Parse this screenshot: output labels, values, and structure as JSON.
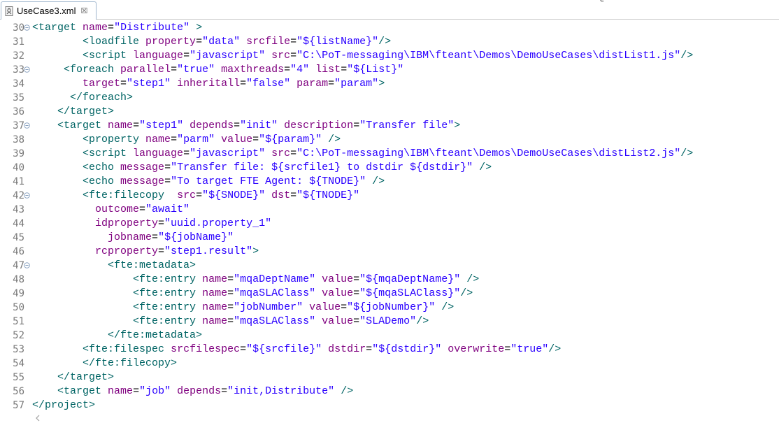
{
  "tab": {
    "title": "UseCase3.xml",
    "close_glyph": "☒",
    "icon": "xml-file-icon"
  },
  "colors": {
    "tag": "#006464",
    "attribute": "#7f007f",
    "value": "#2a00ff",
    "line_number": "#787878",
    "fold_marker": "#8aa2c0"
  },
  "lines": [
    {
      "num": "30",
      "fold": true,
      "tokens": [
        [
          "tag",
          "<target"
        ],
        [
          "plain",
          " "
        ],
        [
          "attr",
          "name"
        ],
        [
          "plain",
          "="
        ],
        [
          "val",
          "\"Distribute\""
        ],
        [
          "plain",
          " "
        ],
        [
          "tag",
          ">"
        ]
      ]
    },
    {
      "num": "31",
      "fold": false,
      "tokens": [
        [
          "plain",
          "        "
        ],
        [
          "tag",
          "<loadfile"
        ],
        [
          "plain",
          " "
        ],
        [
          "attr",
          "property"
        ],
        [
          "plain",
          "="
        ],
        [
          "val",
          "\"data\""
        ],
        [
          "plain",
          " "
        ],
        [
          "attr",
          "srcfile"
        ],
        [
          "plain",
          "="
        ],
        [
          "val",
          "\"${listName}\""
        ],
        [
          "tag",
          "/>"
        ]
      ]
    },
    {
      "num": "32",
      "fold": false,
      "tokens": [
        [
          "plain",
          "        "
        ],
        [
          "tag",
          "<script"
        ],
        [
          "plain",
          " "
        ],
        [
          "attr",
          "language"
        ],
        [
          "plain",
          "="
        ],
        [
          "val",
          "\"javascript\""
        ],
        [
          "plain",
          " "
        ],
        [
          "attr",
          "src"
        ],
        [
          "plain",
          "="
        ],
        [
          "val",
          "\"C:\\PoT-messaging\\IBM\\fteant\\Demos\\DemoUseCases\\distList1.js\""
        ],
        [
          "tag",
          "/>"
        ]
      ]
    },
    {
      "num": "33",
      "fold": true,
      "tokens": [
        [
          "plain",
          "     "
        ],
        [
          "tag",
          "<foreach"
        ],
        [
          "plain",
          " "
        ],
        [
          "attr",
          "parallel"
        ],
        [
          "plain",
          "="
        ],
        [
          "val",
          "\"true\""
        ],
        [
          "plain",
          " "
        ],
        [
          "attr",
          "maxthreads"
        ],
        [
          "plain",
          "="
        ],
        [
          "val",
          "\"4\""
        ],
        [
          "plain",
          " "
        ],
        [
          "attr",
          "list"
        ],
        [
          "plain",
          "="
        ],
        [
          "val",
          "\"${List}\""
        ]
      ]
    },
    {
      "num": "34",
      "fold": false,
      "tokens": [
        [
          "plain",
          "        "
        ],
        [
          "attr",
          "target"
        ],
        [
          "plain",
          "="
        ],
        [
          "val",
          "\"step1\""
        ],
        [
          "plain",
          " "
        ],
        [
          "attr",
          "inheritall"
        ],
        [
          "plain",
          "="
        ],
        [
          "val",
          "\"false\""
        ],
        [
          "plain",
          " "
        ],
        [
          "attr",
          "param"
        ],
        [
          "plain",
          "="
        ],
        [
          "val",
          "\"param\""
        ],
        [
          "tag",
          ">"
        ]
      ]
    },
    {
      "num": "35",
      "fold": false,
      "tokens": [
        [
          "plain",
          "      "
        ],
        [
          "tag",
          "</foreach>"
        ]
      ]
    },
    {
      "num": "36",
      "fold": false,
      "tokens": [
        [
          "plain",
          "    "
        ],
        [
          "tag",
          "</target>"
        ]
      ]
    },
    {
      "num": "37",
      "fold": true,
      "tokens": [
        [
          "plain",
          "    "
        ],
        [
          "tag",
          "<target"
        ],
        [
          "plain",
          " "
        ],
        [
          "attr",
          "name"
        ],
        [
          "plain",
          "="
        ],
        [
          "val",
          "\"step1\""
        ],
        [
          "plain",
          " "
        ],
        [
          "attr",
          "depends"
        ],
        [
          "plain",
          "="
        ],
        [
          "val",
          "\"init\""
        ],
        [
          "plain",
          " "
        ],
        [
          "attr",
          "description"
        ],
        [
          "plain",
          "="
        ],
        [
          "val",
          "\"Transfer file\""
        ],
        [
          "tag",
          ">"
        ]
      ]
    },
    {
      "num": "38",
      "fold": false,
      "tokens": [
        [
          "plain",
          "        "
        ],
        [
          "tag",
          "<property"
        ],
        [
          "plain",
          " "
        ],
        [
          "attr",
          "name"
        ],
        [
          "plain",
          "="
        ],
        [
          "val",
          "\"parm\""
        ],
        [
          "plain",
          " "
        ],
        [
          "attr",
          "value"
        ],
        [
          "plain",
          "="
        ],
        [
          "val",
          "\"${param}\""
        ],
        [
          "plain",
          " "
        ],
        [
          "tag",
          "/>"
        ]
      ]
    },
    {
      "num": "39",
      "fold": false,
      "tokens": [
        [
          "plain",
          "        "
        ],
        [
          "tag",
          "<script"
        ],
        [
          "plain",
          " "
        ],
        [
          "attr",
          "language"
        ],
        [
          "plain",
          "="
        ],
        [
          "val",
          "\"javascript\""
        ],
        [
          "plain",
          " "
        ],
        [
          "attr",
          "src"
        ],
        [
          "plain",
          "="
        ],
        [
          "val",
          "\"C:\\PoT-messaging\\IBM\\fteant\\Demos\\DemoUseCases\\distList2.js\""
        ],
        [
          "tag",
          "/>"
        ]
      ]
    },
    {
      "num": "40",
      "fold": false,
      "tokens": [
        [
          "plain",
          "        "
        ],
        [
          "tag",
          "<echo"
        ],
        [
          "plain",
          " "
        ],
        [
          "attr",
          "message"
        ],
        [
          "plain",
          "="
        ],
        [
          "val",
          "\"Transfer file: ${srcfile1} to dstdir ${dstdir}\""
        ],
        [
          "plain",
          " "
        ],
        [
          "tag",
          "/>"
        ]
      ]
    },
    {
      "num": "41",
      "fold": false,
      "tokens": [
        [
          "plain",
          "        "
        ],
        [
          "tag",
          "<echo"
        ],
        [
          "plain",
          " "
        ],
        [
          "attr",
          "message"
        ],
        [
          "plain",
          "="
        ],
        [
          "val",
          "\"To target FTE Agent: ${TNODE}\""
        ],
        [
          "plain",
          " "
        ],
        [
          "tag",
          "/>"
        ]
      ]
    },
    {
      "num": "42",
      "fold": true,
      "tokens": [
        [
          "plain",
          "        "
        ],
        [
          "tag",
          "<fte:filecopy"
        ],
        [
          "plain",
          "  "
        ],
        [
          "attr",
          "src"
        ],
        [
          "plain",
          "="
        ],
        [
          "val",
          "\"${SNODE}\""
        ],
        [
          "plain",
          " "
        ],
        [
          "attr",
          "dst"
        ],
        [
          "plain",
          "="
        ],
        [
          "val",
          "\"${TNODE}\""
        ]
      ]
    },
    {
      "num": "43",
      "fold": false,
      "tokens": [
        [
          "plain",
          "          "
        ],
        [
          "attr",
          "outcome"
        ],
        [
          "plain",
          "="
        ],
        [
          "val",
          "\"await\""
        ]
      ]
    },
    {
      "num": "44",
      "fold": false,
      "tokens": [
        [
          "plain",
          "          "
        ],
        [
          "attr",
          "idproperty"
        ],
        [
          "plain",
          "="
        ],
        [
          "val",
          "\"uuid.property_1\""
        ]
      ]
    },
    {
      "num": "45",
      "fold": false,
      "tokens": [
        [
          "plain",
          "            "
        ],
        [
          "attr",
          "jobname"
        ],
        [
          "plain",
          "="
        ],
        [
          "val",
          "\"${jobName}\""
        ]
      ]
    },
    {
      "num": "46",
      "fold": false,
      "tokens": [
        [
          "plain",
          "          "
        ],
        [
          "attr",
          "rcproperty"
        ],
        [
          "plain",
          "="
        ],
        [
          "val",
          "\"step1.result\""
        ],
        [
          "tag",
          ">"
        ]
      ]
    },
    {
      "num": "47",
      "fold": true,
      "tokens": [
        [
          "plain",
          "            "
        ],
        [
          "tag",
          "<fte:metadata>"
        ]
      ]
    },
    {
      "num": "48",
      "fold": false,
      "tokens": [
        [
          "plain",
          "                "
        ],
        [
          "tag",
          "<fte:entry"
        ],
        [
          "plain",
          " "
        ],
        [
          "attr",
          "name"
        ],
        [
          "plain",
          "="
        ],
        [
          "val",
          "\"mqaDeptName\""
        ],
        [
          "plain",
          " "
        ],
        [
          "attr",
          "value"
        ],
        [
          "plain",
          "="
        ],
        [
          "val",
          "\"${mqaDeptName}\""
        ],
        [
          "plain",
          " "
        ],
        [
          "tag",
          "/>"
        ]
      ]
    },
    {
      "num": "49",
      "fold": false,
      "tokens": [
        [
          "plain",
          "                "
        ],
        [
          "tag",
          "<fte:entry"
        ],
        [
          "plain",
          " "
        ],
        [
          "attr",
          "name"
        ],
        [
          "plain",
          "="
        ],
        [
          "val",
          "\"mqaSLAClass\""
        ],
        [
          "plain",
          " "
        ],
        [
          "attr",
          "value"
        ],
        [
          "plain",
          "="
        ],
        [
          "val",
          "\"${mqaSLAClass}\""
        ],
        [
          "tag",
          "/>"
        ]
      ]
    },
    {
      "num": "50",
      "fold": false,
      "tokens": [
        [
          "plain",
          "                "
        ],
        [
          "tag",
          "<fte:entry"
        ],
        [
          "plain",
          " "
        ],
        [
          "attr",
          "name"
        ],
        [
          "plain",
          "="
        ],
        [
          "val",
          "\"jobNumber\""
        ],
        [
          "plain",
          " "
        ],
        [
          "attr",
          "value"
        ],
        [
          "plain",
          "="
        ],
        [
          "val",
          "\"${jobNumber}\""
        ],
        [
          "plain",
          " "
        ],
        [
          "tag",
          "/>"
        ]
      ]
    },
    {
      "num": "51",
      "fold": false,
      "tokens": [
        [
          "plain",
          "                "
        ],
        [
          "tag",
          "<fte:entry"
        ],
        [
          "plain",
          " "
        ],
        [
          "attr",
          "name"
        ],
        [
          "plain",
          "="
        ],
        [
          "val",
          "\"mqaSLAClass\""
        ],
        [
          "plain",
          " "
        ],
        [
          "attr",
          "value"
        ],
        [
          "plain",
          "="
        ],
        [
          "val",
          "\"SLADemo\""
        ],
        [
          "tag",
          "/>"
        ]
      ]
    },
    {
      "num": "52",
      "fold": false,
      "tokens": [
        [
          "plain",
          "            "
        ],
        [
          "tag",
          "</fte:metadata>"
        ]
      ]
    },
    {
      "num": "53",
      "fold": false,
      "tokens": [
        [
          "plain",
          "        "
        ],
        [
          "tag",
          "<fte:filespec"
        ],
        [
          "plain",
          " "
        ],
        [
          "attr",
          "srcfilespec"
        ],
        [
          "plain",
          "="
        ],
        [
          "val",
          "\"${srcfile}\""
        ],
        [
          "plain",
          " "
        ],
        [
          "attr",
          "dstdir"
        ],
        [
          "plain",
          "="
        ],
        [
          "val",
          "\"${dstdir}\""
        ],
        [
          "plain",
          " "
        ],
        [
          "attr",
          "overwrite"
        ],
        [
          "plain",
          "="
        ],
        [
          "val",
          "\"true\""
        ],
        [
          "tag",
          "/>"
        ]
      ]
    },
    {
      "num": "54",
      "fold": false,
      "tokens": [
        [
          "plain",
          "        "
        ],
        [
          "tag",
          "</fte:filecopy>"
        ]
      ]
    },
    {
      "num": "55",
      "fold": false,
      "tokens": [
        [
          "plain",
          "    "
        ],
        [
          "tag",
          "</target>"
        ]
      ]
    },
    {
      "num": "56",
      "fold": false,
      "tokens": [
        [
          "plain",
          "    "
        ],
        [
          "tag",
          "<target"
        ],
        [
          "plain",
          " "
        ],
        [
          "attr",
          "name"
        ],
        [
          "plain",
          "="
        ],
        [
          "val",
          "\"job\""
        ],
        [
          "plain",
          " "
        ],
        [
          "attr",
          "depends"
        ],
        [
          "plain",
          "="
        ],
        [
          "val",
          "\"init,Distribute\""
        ],
        [
          "plain",
          " "
        ],
        [
          "tag",
          "/>"
        ]
      ]
    },
    {
      "num": "57",
      "fold": false,
      "tokens": [
        [
          "tag",
          "</project>"
        ]
      ]
    }
  ],
  "scrollbar": {
    "left_arrow": "<"
  }
}
